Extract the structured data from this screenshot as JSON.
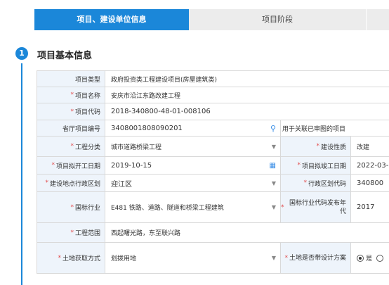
{
  "tabs": {
    "active": "项目、建设单位信息",
    "stage": "项目阶段"
  },
  "section": {
    "number": "1",
    "title": "项目基本信息"
  },
  "req_mark": "*",
  "form": {
    "project_type": {
      "label": "项目类型",
      "value": "政府投资类工程建设项目(房屋建筑类)"
    },
    "project_name": {
      "label": "项目名称",
      "value": "安庆市沿江东路改建工程"
    },
    "project_code": {
      "label": "项目代码",
      "value": "2018-340800-48-01-008106"
    },
    "province_code": {
      "label": "省厅项目编号",
      "value": "3408001808090201",
      "hint": "用于关联已审图的项目"
    },
    "engineering_category": {
      "label": "工程分类",
      "value": "城市道路桥梁工程"
    },
    "construction_nature": {
      "label": "建设性质",
      "value": "改建"
    },
    "start_date": {
      "label": "项目拟开工日期",
      "value": "2019-10-15"
    },
    "end_date": {
      "label": "项目拟竣工日期",
      "value": "2022-03-0"
    },
    "district": {
      "label": "建设地点行政区划",
      "value": "迎江区"
    },
    "district_code": {
      "label": "行政区划代码",
      "value": "340800"
    },
    "industry": {
      "label": "国标行业",
      "value": "E481 铁路、道路、隧道和桥梁工程建筑"
    },
    "industry_year": {
      "label": "国标行业代码发布年代",
      "value": "2017"
    },
    "scope": {
      "label": "工程范围",
      "value": "西起曙光路，东至联兴路"
    },
    "land_method": {
      "label": "土地获取方式",
      "value": "划拨用地"
    },
    "design_plan": {
      "label": "土地是否带设计方案",
      "yes": "是"
    }
  }
}
